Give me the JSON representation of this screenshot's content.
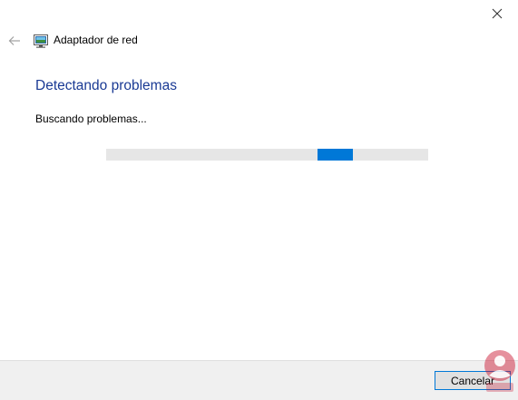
{
  "window": {
    "title": "Adaptador de red",
    "close_icon": "close-icon",
    "back_icon": "back-arrow-icon",
    "app_icon": "network-adapter-icon"
  },
  "main": {
    "heading": "Detectando problemas",
    "status": "Buscando problemas..."
  },
  "progress": {
    "type": "indeterminate-marquee",
    "chunk_start_fraction": 0.656,
    "chunk_length_fraction": 0.11
  },
  "footer": {
    "cancel_label": "Cancelar"
  },
  "colors": {
    "accent": "#0078d7",
    "heading": "#1a3a94",
    "track": "#e6e6e6",
    "footer_bg": "#f0f0f0"
  },
  "watermark": {
    "icon": "user-badge-watermark"
  }
}
